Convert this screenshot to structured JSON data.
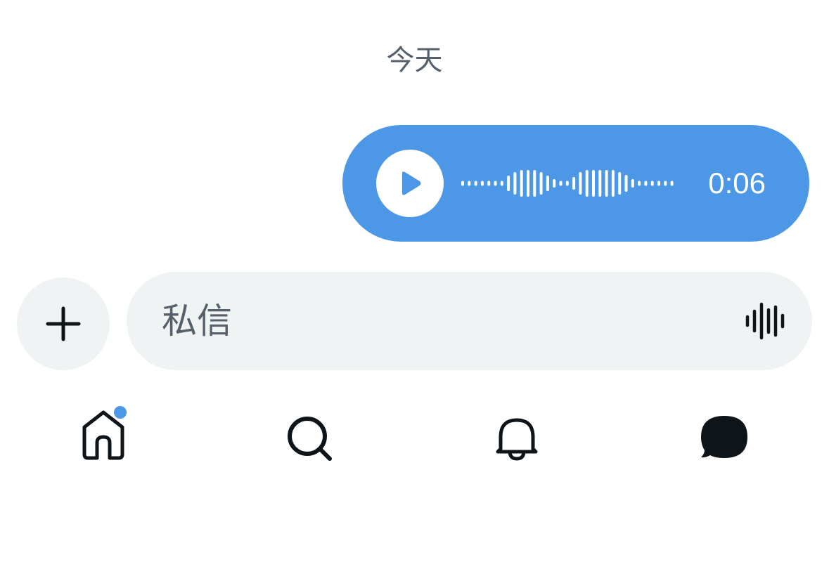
{
  "conversation": {
    "date_separator": "今天",
    "voice_message": {
      "duration": "0:06",
      "icon": "play-icon",
      "waveform_icon": "waveform-icon"
    }
  },
  "composer": {
    "placeholder": "私信",
    "add_icon": "plus-icon",
    "voice_icon": "voice-record-icon"
  },
  "tabbar": {
    "items": [
      {
        "name": "home",
        "icon": "home-icon",
        "active": false,
        "badge": true
      },
      {
        "name": "search",
        "icon": "search-icon",
        "active": false,
        "badge": false
      },
      {
        "name": "notifications",
        "icon": "bell-icon",
        "active": false,
        "badge": false
      },
      {
        "name": "messages",
        "icon": "message-bubble-icon",
        "active": true,
        "badge": false
      }
    ]
  },
  "colors": {
    "accent": "#4c98e6",
    "bubble_text": "#ffffff",
    "secondary_text": "#56606b",
    "input_bg": "#eff3f4",
    "icon": "#0f1419"
  }
}
